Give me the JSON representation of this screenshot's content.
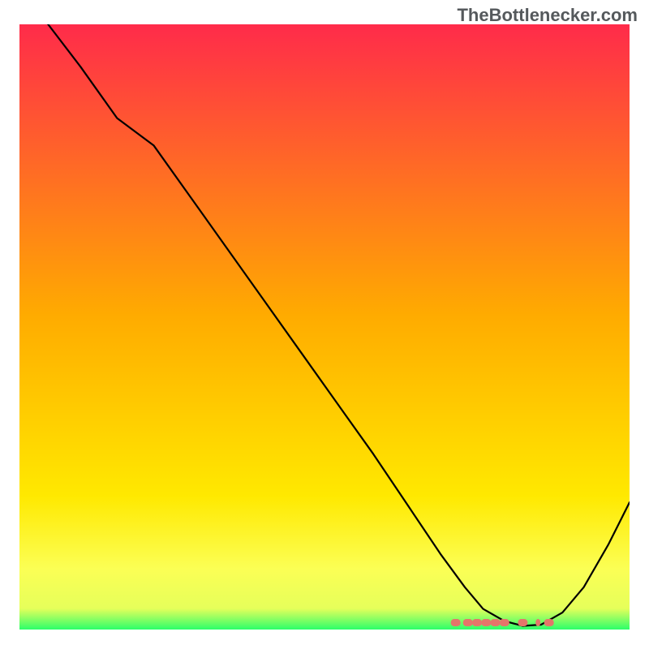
{
  "watermark": "TheBottlenecker.com",
  "chart_data": {
    "type": "line",
    "title": "",
    "xlabel": "",
    "ylabel": "",
    "xlim": [
      0,
      100
    ],
    "ylim": [
      0,
      100
    ],
    "gradient_stops": [
      {
        "pos": 0.0,
        "color": "#ff2b4a"
      },
      {
        "pos": 0.48,
        "color": "#ffab00"
      },
      {
        "pos": 0.78,
        "color": "#ffe900"
      },
      {
        "pos": 0.9,
        "color": "#fbff55"
      },
      {
        "pos": 0.965,
        "color": "#e6ff5a"
      },
      {
        "pos": 0.985,
        "color": "#7cff64"
      },
      {
        "pos": 1.0,
        "color": "#2cff6a"
      }
    ],
    "series": [
      {
        "name": "bottleneck-curve",
        "x": [
          0.0,
          4.7,
          10.0,
          16.0,
          22.0,
          28.0,
          34.0,
          40.0,
          46.0,
          52.0,
          58.0,
          64.0,
          69.0,
          73.0,
          76.0,
          79.5,
          82.5,
          85.5,
          89.0,
          92.5,
          96.5,
          100.0
        ],
        "y": [
          105.0,
          100.0,
          93.0,
          84.5,
          80.0,
          71.5,
          63.0,
          54.5,
          46.0,
          37.5,
          29.0,
          20.0,
          12.5,
          7.0,
          3.4,
          1.4,
          0.6,
          0.8,
          2.8,
          7.0,
          14.0,
          21.0
        ]
      },
      {
        "name": "highlight-markers",
        "x": [
          71.5,
          73.5,
          75.0,
          76.5,
          78.0,
          79.5,
          82.5,
          85.0,
          86.8
        ],
        "y": [
          1.2,
          1.2,
          1.2,
          1.2,
          1.2,
          1.2,
          1.2,
          1.2,
          1.2
        ]
      }
    ]
  }
}
